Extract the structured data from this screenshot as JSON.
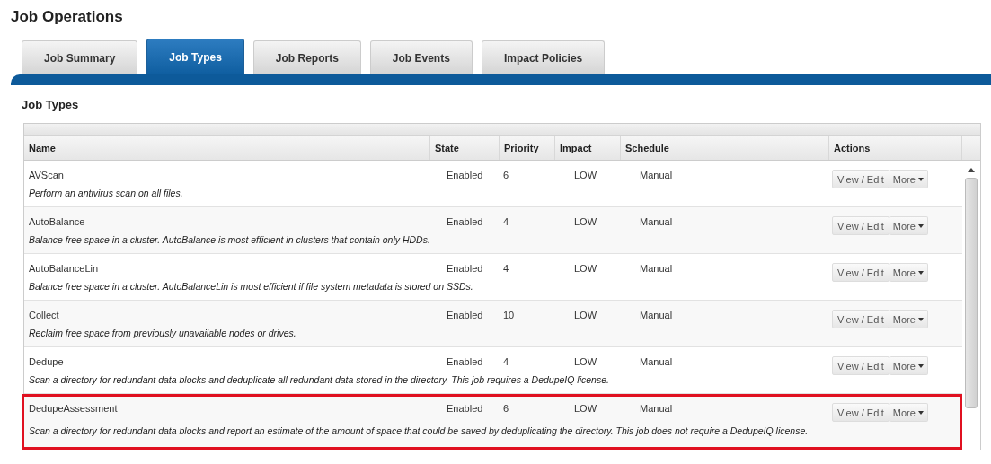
{
  "page_title": "Job Operations",
  "tabs": [
    {
      "label": "Job Summary",
      "selected": false
    },
    {
      "label": "Job Types",
      "selected": true
    },
    {
      "label": "Job Reports",
      "selected": false
    },
    {
      "label": "Job Events",
      "selected": false
    },
    {
      "label": "Impact Policies",
      "selected": false
    }
  ],
  "section_title": "Job Types",
  "table": {
    "columns": [
      "Name",
      "State",
      "Priority",
      "Impact",
      "Schedule",
      "Actions"
    ],
    "rows": [
      {
        "name": "AVScan",
        "description": "Perform an antivirus scan on all files.",
        "state": "Enabled",
        "priority": "6",
        "impact": "LOW",
        "schedule": "Manual",
        "actions": [
          "View / Edit",
          "More"
        ],
        "highlighted": false
      },
      {
        "name": "AutoBalance",
        "description": "Balance free space in a cluster. AutoBalance is most efficient in clusters that contain only HDDs.",
        "state": "Enabled",
        "priority": "4",
        "impact": "LOW",
        "schedule": "Manual",
        "actions": [
          "View / Edit",
          "More"
        ],
        "highlighted": false
      },
      {
        "name": "AutoBalanceLin",
        "description": "Balance free space in a cluster. AutoBalanceLin is most efficient if file system metadata is stored on SSDs.",
        "state": "Enabled",
        "priority": "4",
        "impact": "LOW",
        "schedule": "Manual",
        "actions": [
          "View / Edit",
          "More"
        ],
        "highlighted": false
      },
      {
        "name": "Collect",
        "description": "Reclaim free space from previously unavailable nodes or drives.",
        "state": "Enabled",
        "priority": "10",
        "impact": "LOW",
        "schedule": "Manual",
        "actions": [
          "View / Edit",
          "More"
        ],
        "highlighted": false
      },
      {
        "name": "Dedupe",
        "description": "Scan a directory for redundant data blocks and deduplicate all redundant data stored in the directory. This job requires a DedupeIQ license.",
        "state": "Enabled",
        "priority": "4",
        "impact": "LOW",
        "schedule": "Manual",
        "actions": [
          "View / Edit",
          "More"
        ],
        "highlighted": false
      },
      {
        "name": "DedupeAssessment",
        "description": "Scan a directory for redundant data blocks and report an estimate of the amount of space that could be saved by deduplicating the directory. This job does not require a DedupeIQ license.",
        "state": "Enabled",
        "priority": "6",
        "impact": "LOW",
        "schedule": "Manual",
        "actions": [
          "View / Edit",
          "More"
        ],
        "highlighted": true
      }
    ]
  }
}
